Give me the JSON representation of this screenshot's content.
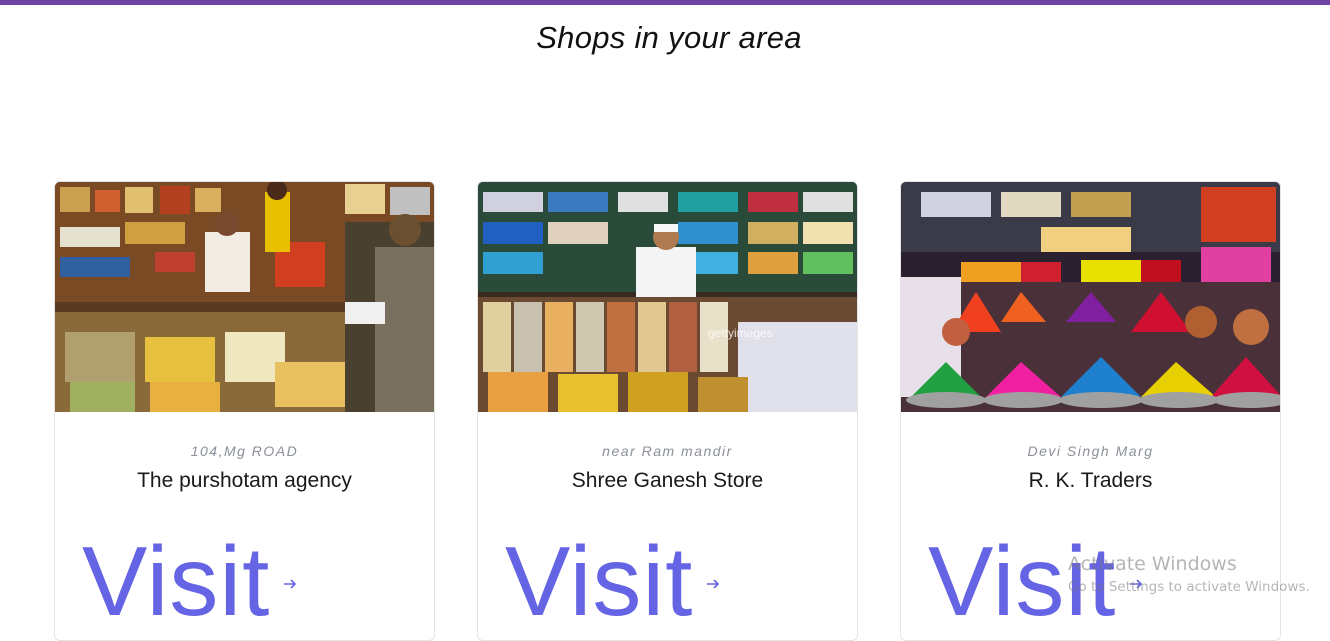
{
  "page": {
    "title": "Shops in your area"
  },
  "shops": [
    {
      "address": "104,Mg ROAD",
      "name": "The purshotam agency",
      "visit_label": "Visit"
    },
    {
      "address": "near Ram mandir",
      "name": "Shree Ganesh Store",
      "visit_label": "Visit"
    },
    {
      "address": "Devi Singh Marg",
      "name": "R. K. Traders",
      "visit_label": "Visit"
    }
  ],
  "overlay": {
    "title": "Activate Windows",
    "subtitle": "Go to Settings to activate Windows."
  },
  "colors": {
    "accent": "#6464e4",
    "top_bar": "#6f42a8"
  }
}
